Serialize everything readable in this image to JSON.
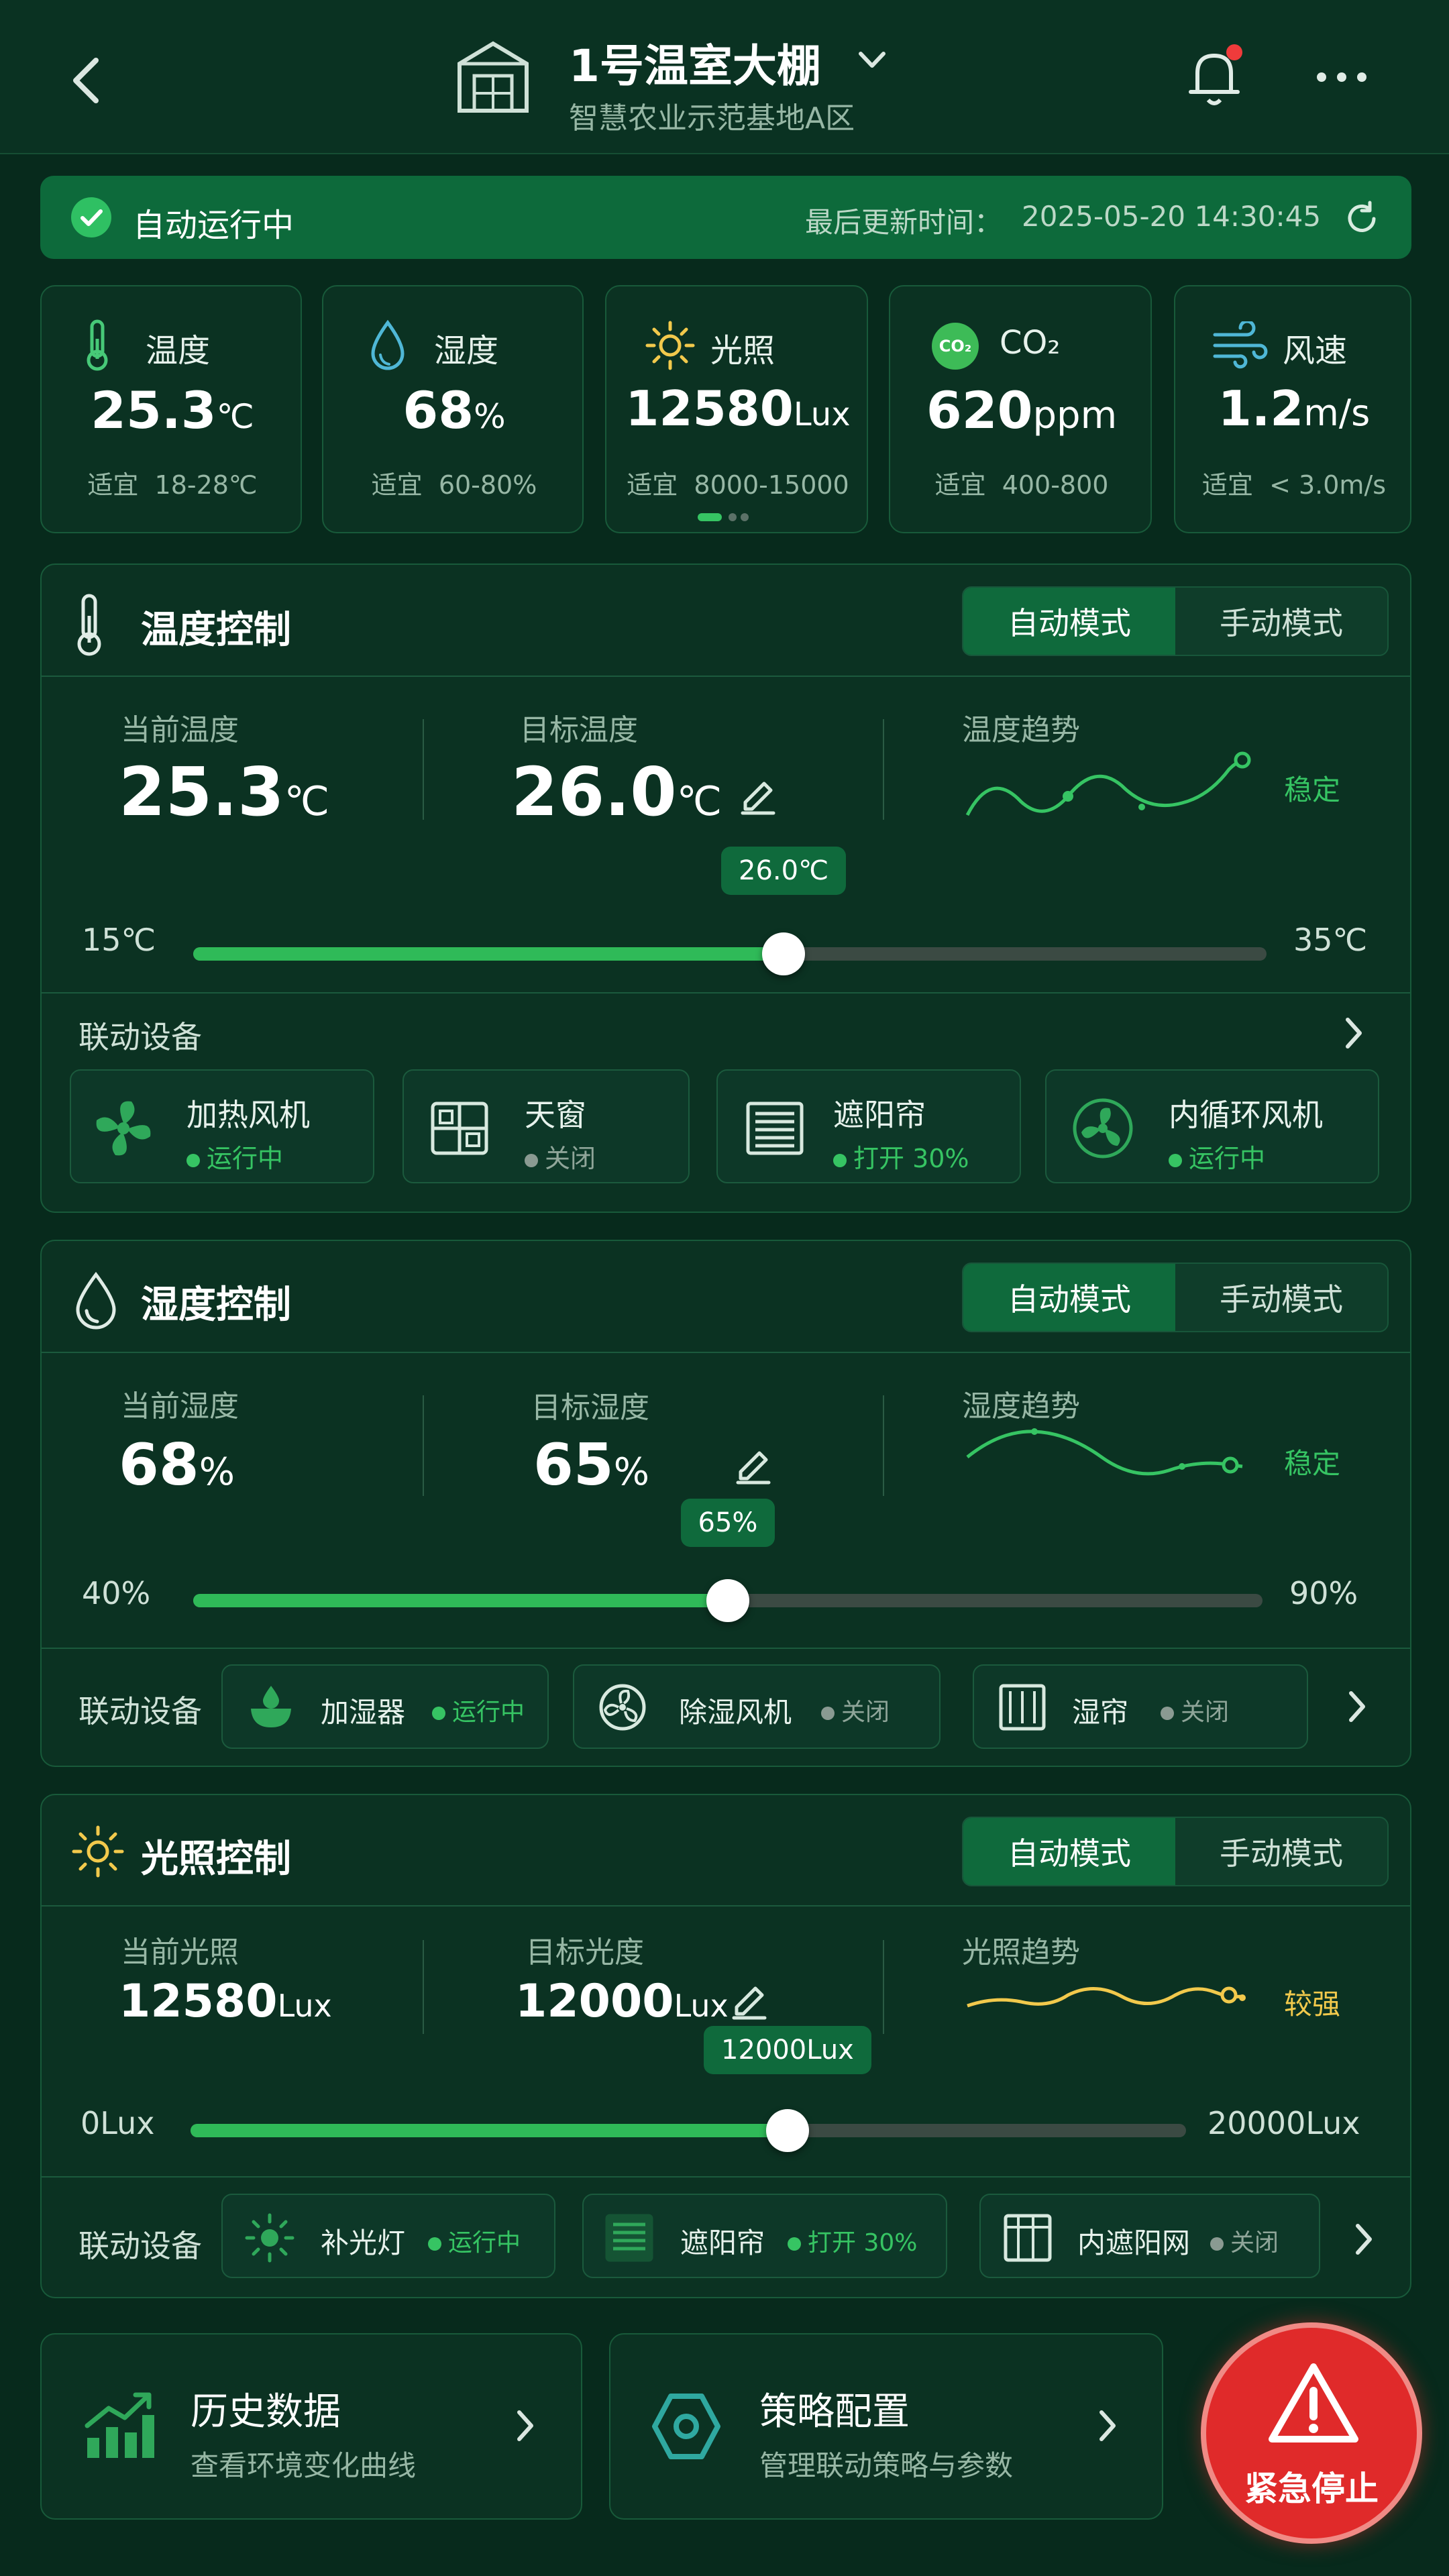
{
  "header": {
    "title": "1号温室大棚",
    "subtitle": "智慧农业示范基地A区"
  },
  "status": {
    "text": "自动运行中",
    "update_label": "最后更新时间：",
    "update_time": "2025-05-20 14:30:45"
  },
  "metrics": [
    {
      "label": "温度",
      "value": "25.3",
      "unit": "℃",
      "range": "适宜  18-28℃"
    },
    {
      "label": "湿度",
      "value": "68",
      "unit": "%",
      "range": "适宜  60-80%"
    },
    {
      "label": "光照",
      "value": "12580",
      "unit": "Lux",
      "range": "适宜  8000-15000"
    },
    {
      "label": "CO₂",
      "value": "620",
      "unit": "ppm",
      "range": "适宜  400-800"
    },
    {
      "label": "风速",
      "value": "1.2",
      "unit": "m/s",
      "range": "适宜  < 3.0m/s"
    }
  ],
  "temp": {
    "title": "温度控制",
    "mode_auto": "自动模式",
    "mode_manual": "手动模式",
    "current_label": "当前温度",
    "current_value": "25.3",
    "current_unit": "℃",
    "target_label": "目标温度",
    "target_value": "26.0",
    "target_unit": "℃",
    "trend_label": "温度趋势",
    "trend_status": "稳定",
    "slider_min": "15℃",
    "slider_max": "35℃",
    "slider_tip": "26.0℃",
    "slider_fraction": 0.55,
    "devices_label": "联动设备",
    "devices": [
      {
        "name": "加热风机",
        "status": "运行中"
      },
      {
        "name": "天窗",
        "status": "关闭"
      },
      {
        "name": "遮阳帘",
        "status": "打开 30%"
      },
      {
        "name": "内循环风机",
        "status": "运行中"
      }
    ]
  },
  "humid": {
    "title": "湿度控制",
    "mode_auto": "自动模式",
    "mode_manual": "手动模式",
    "current_label": "当前湿度",
    "current_value": "68",
    "current_unit": "%",
    "target_label": "目标湿度",
    "target_value": "65",
    "target_unit": "%",
    "trend_label": "湿度趋势",
    "trend_status": "稳定",
    "slider_min": "40%",
    "slider_max": "90%",
    "slider_tip": "65%",
    "slider_fraction": 0.5,
    "devices_label": "联动设备",
    "devices": [
      {
        "name": "加湿器",
        "status": "运行中"
      },
      {
        "name": "除湿风机",
        "status": "关闭"
      },
      {
        "name": "湿帘",
        "status": "关闭"
      }
    ]
  },
  "light": {
    "title": "光照控制",
    "mode_auto": "自动模式",
    "mode_manual": "手动模式",
    "current_label": "当前光照",
    "current_value": "12580",
    "current_unit": "Lux",
    "target_label": "目标光度",
    "target_value": "12000",
    "target_unit": "Lux",
    "trend_label": "光照趋势",
    "trend_status": "较强",
    "slider_min": "0Lux",
    "slider_max": "20000Lux",
    "slider_tip": "12000Lux",
    "slider_fraction": 0.6,
    "devices_label": "联动设备",
    "devices": [
      {
        "name": "补光灯",
        "status": "运行中"
      },
      {
        "name": "遮阳帘",
        "status": "打开 30%"
      },
      {
        "name": "内遮阳网",
        "status": "关闭"
      }
    ]
  },
  "bottom": {
    "history_title": "历史数据",
    "history_sub": "查看环境变化曲线",
    "strategy_title": "策略配置",
    "strategy_sub": "管理联动策略与参数",
    "emergency": "紧急停止"
  },
  "colors": {
    "accent": "#36c463",
    "warning": "#f2c94c",
    "danger": "#e53935",
    "bg": "#072a1c"
  }
}
